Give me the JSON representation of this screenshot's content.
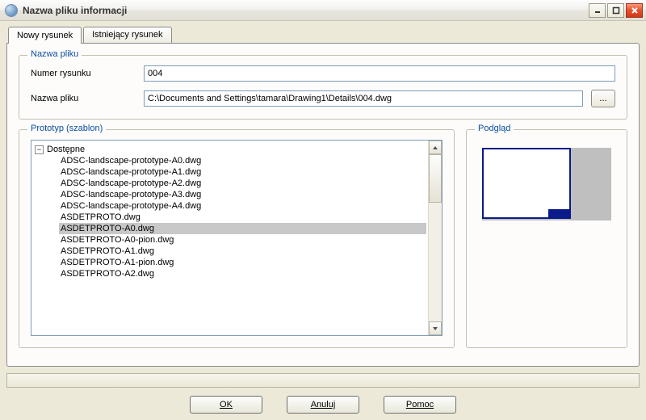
{
  "window": {
    "title": "Nazwa pliku informacji"
  },
  "tabs": {
    "new": "Nowy rysunek",
    "existing": "Istniejący rysunek"
  },
  "filename_group": {
    "legend": "Nazwa pliku",
    "number_label": "Numer rysunku",
    "number_value": "004",
    "path_label": "Nazwa pliku",
    "path_value": "C:\\Documents and Settings\\tamara\\Drawing1\\Details\\004.dwg",
    "browse_label": "..."
  },
  "prototype_group": {
    "legend": "Prototyp (szablon)",
    "root_label": "Dostępne",
    "items": [
      "ADSC-landscape-prototype-A0.dwg",
      "ADSC-landscape-prototype-A1.dwg",
      "ADSC-landscape-prototype-A2.dwg",
      "ADSC-landscape-prototype-A3.dwg",
      "ADSC-landscape-prototype-A4.dwg",
      "ASDETPROTO.dwg",
      "ASDETPROTO-A0.dwg",
      "ASDETPROTO-A0-pion.dwg",
      "ASDETPROTO-A1.dwg",
      "ASDETPROTO-A1-pion.dwg",
      "ASDETPROTO-A2.dwg"
    ],
    "selected_index": 6
  },
  "preview_group": {
    "legend": "Podgląd"
  },
  "buttons": {
    "ok": "OK",
    "cancel": "Anuluj",
    "help": "Pomoc"
  }
}
